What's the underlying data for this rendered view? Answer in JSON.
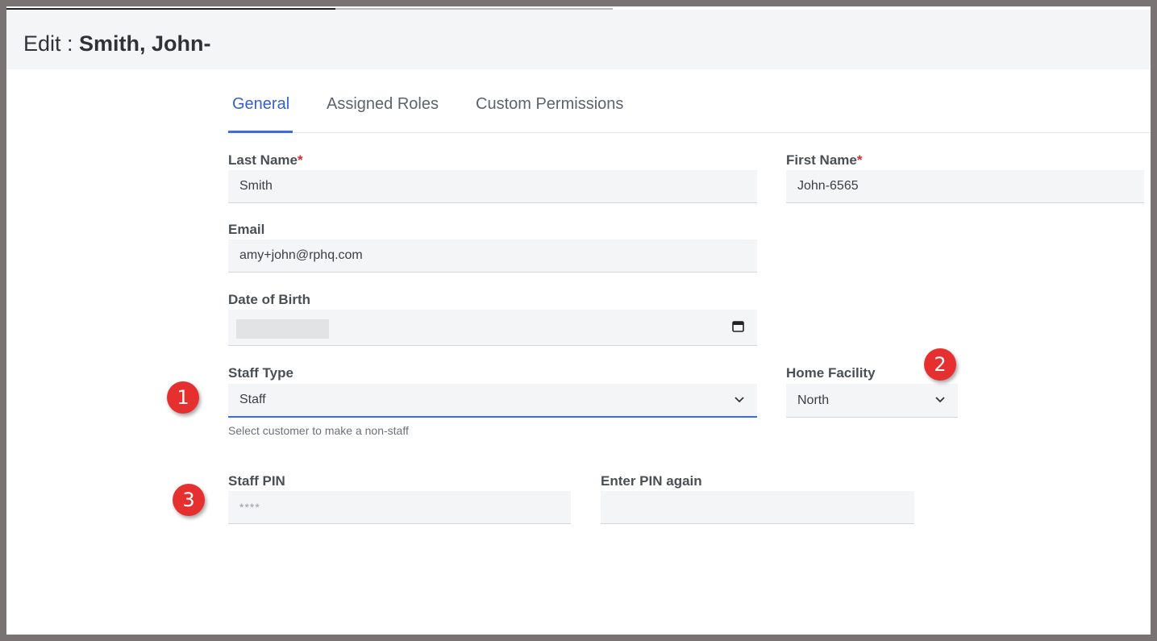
{
  "header": {
    "prefix": "Edit : ",
    "name": "Smith, John-"
  },
  "tabs": [
    {
      "label": "General",
      "active": true
    },
    {
      "label": "Assigned Roles",
      "active": false
    },
    {
      "label": "Custom Permissions",
      "active": false
    }
  ],
  "form": {
    "last_name": {
      "label": "Last Name",
      "required_mark": "*",
      "value": "Smith"
    },
    "first_name": {
      "label": "First Name",
      "required_mark": "*",
      "value": "John-6565"
    },
    "email": {
      "label": "Email",
      "value": "amy+john@rphq.com"
    },
    "dob": {
      "label": "Date of Birth",
      "icon": "calendar-icon"
    },
    "staff_type": {
      "label": "Staff Type",
      "value": "Staff",
      "help": "Select customer to make a non-staff"
    },
    "home_facility": {
      "label": "Home Facility",
      "value": "North"
    },
    "staff_pin": {
      "label": "Staff PIN",
      "placeholder": "****"
    },
    "pin_again": {
      "label": "Enter PIN again",
      "value": ""
    }
  },
  "markers": [
    "1",
    "2",
    "3"
  ],
  "colors": {
    "accent": "#3b6fd6",
    "marker": "#e5302f",
    "required": "#d0332f"
  }
}
